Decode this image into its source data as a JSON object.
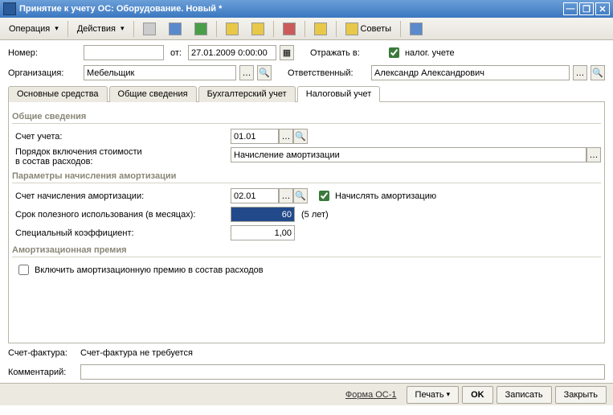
{
  "window": {
    "title": "Принятие к учету ОС: Оборудование. Новый *"
  },
  "toolbar": {
    "operation": "Операция",
    "actions": "Действия",
    "advice": "Советы"
  },
  "header": {
    "number_label": "Номер:",
    "number_value": "",
    "from_label": "от:",
    "date_value": "27.01.2009 0:00:00",
    "reflect_label": "Отражать в:",
    "tax_check": "налог. учете",
    "org_label": "Организация:",
    "org_value": "Мебельщик",
    "resp_label": "Ответственный:",
    "resp_value": "Александр Александрович"
  },
  "tabs": {
    "t1": "Основные средства",
    "t2": "Общие сведения",
    "t3": "Бухгалтерский учет",
    "t4": "Налоговый учет"
  },
  "sec_general": {
    "title": "Общие сведения",
    "account_label": "Счет учета:",
    "account_value": "01.01",
    "cost_order_label1": "Порядок включения стоимости",
    "cost_order_label2": "в состав расходов:",
    "cost_order_value": "Начисление амортизации"
  },
  "sec_amort": {
    "title": "Параметры начисления амортизации",
    "amort_account_label": "Счет начисления амортизации:",
    "amort_account_value": "02.01",
    "do_amort_check": "Начислять амортизацию",
    "useful_life_label": "Срок полезного использования (в месяцах):",
    "useful_life_value": "60",
    "useful_life_hint": "(5 лет)",
    "coef_label": "Специальный коэффициент:",
    "coef_value": "1,00"
  },
  "sec_bonus": {
    "title": "Амортизационная премия",
    "include_check": "Включить амортизационную премию в состав расходов"
  },
  "footer": {
    "invoice_label": "Счет-фактура:",
    "invoice_value": "Счет-фактура не требуется",
    "comment_label": "Комментарий:",
    "comment_value": ""
  },
  "statusbar": {
    "form": "Форма ОС-1",
    "print": "Печать",
    "ok": "OK",
    "save": "Записать",
    "close": "Закрыть"
  }
}
